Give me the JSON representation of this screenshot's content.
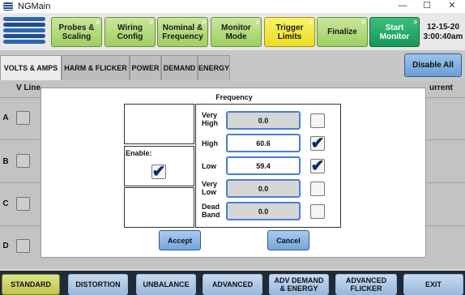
{
  "window": {
    "title": "NGMain",
    "minimize": "—",
    "maximize": "☐",
    "close": "✕"
  },
  "toolbar": {
    "buttons": [
      {
        "label": "Probes & Scaling",
        "corner": ">"
      },
      {
        "label": "Wiring Config",
        "corner": ">"
      },
      {
        "label": "Nominal & Frequency",
        "corner": ">"
      },
      {
        "label": "Monitor Mode",
        "corner": ">"
      },
      {
        "label": "Trigger Limits",
        "corner": ">"
      },
      {
        "label": "Finalize",
        "corner": ">"
      },
      {
        "label": "Start Monitor",
        "corner": ">"
      }
    ],
    "date": "12-15-20",
    "time": "3:00:40am"
  },
  "tabs": [
    "VOLTS & AMPS",
    "HARM & FLICKER",
    "POWER",
    "DEMAND",
    "ENERGY"
  ],
  "disable_all": "Disable All",
  "background": {
    "col_left": "V Line",
    "col_right": "urrent",
    "rows": [
      "A",
      "B",
      "C",
      "D"
    ]
  },
  "dialog": {
    "title": "Frequency",
    "enable_label": "Enable:",
    "enable_checked": true,
    "limits": [
      {
        "label": "Very High",
        "value": "0.0",
        "enabled": false,
        "checked": false
      },
      {
        "label": "High",
        "value": "60.6",
        "enabled": true,
        "checked": true
      },
      {
        "label": "Low",
        "value": "59.4",
        "enabled": true,
        "checked": true
      },
      {
        "label": "Very Low",
        "value": "0.0",
        "enabled": false,
        "checked": false
      },
      {
        "label": "Dead Band",
        "value": "0.0",
        "enabled": false,
        "checked": false
      }
    ],
    "accept": "Accept",
    "cancel": "Cancel"
  },
  "bottom_nav": [
    "STANDARD",
    "DISTORTION",
    "UNBALANCE",
    "ADVANCED",
    "ADV DEMAND & ENERGY",
    "ADVANCED FLICKER",
    "EXIT"
  ],
  "check_glyph": "✔"
}
